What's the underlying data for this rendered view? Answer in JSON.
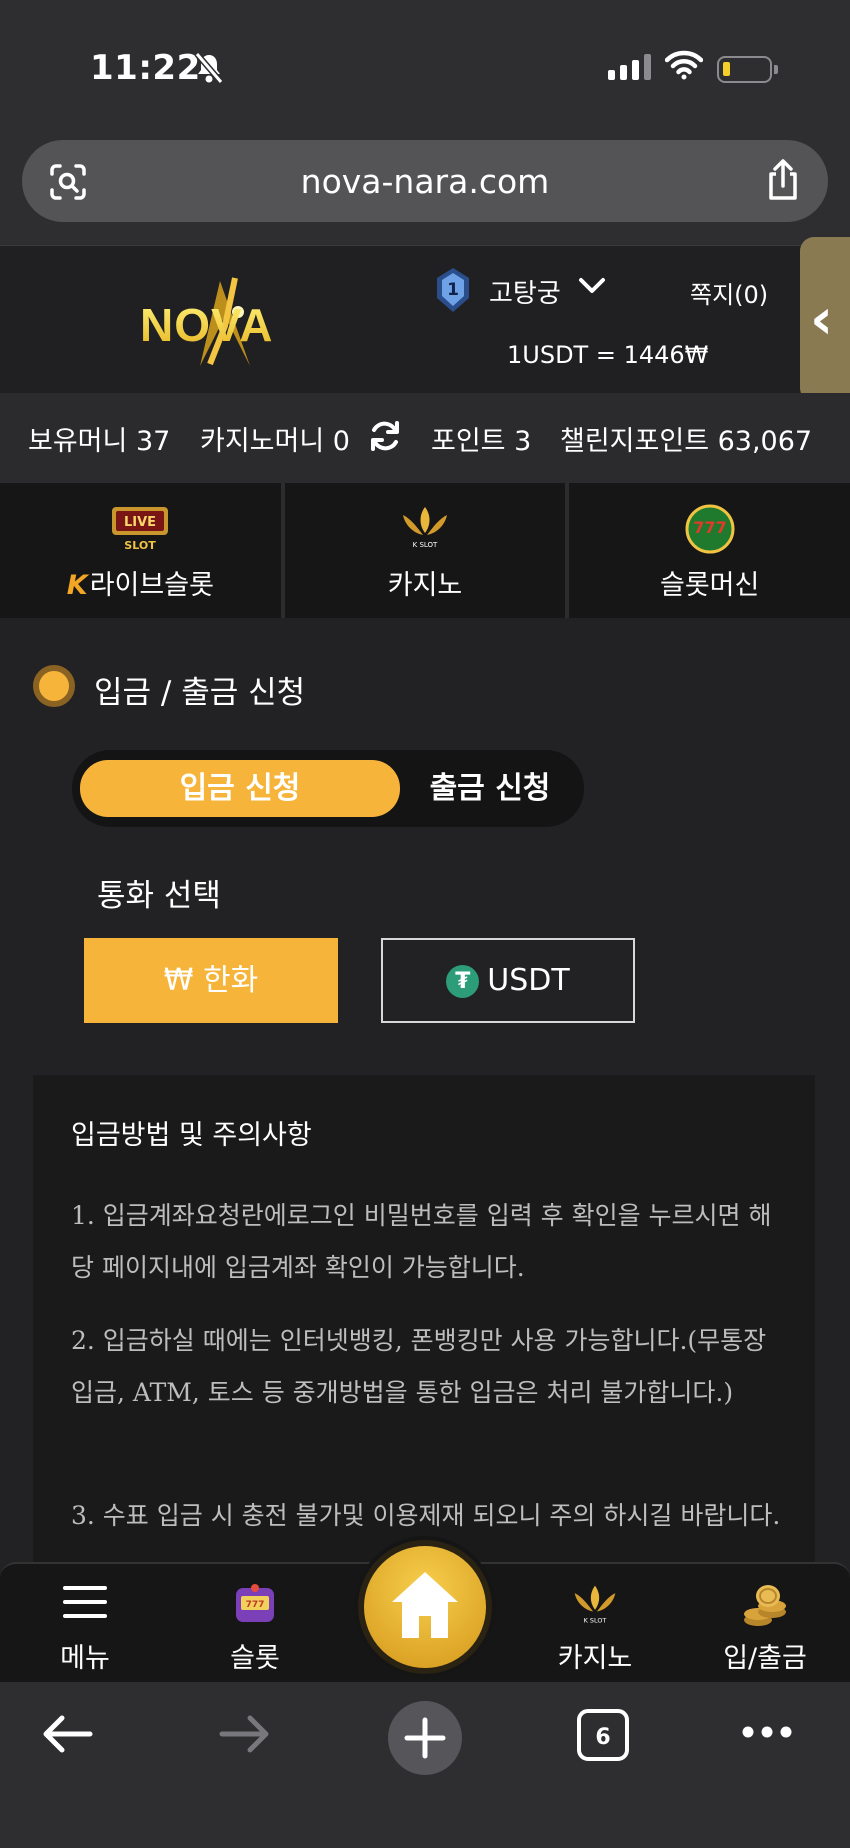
{
  "status_bar": {
    "time": "11:22"
  },
  "address_bar": {
    "url": "nova-nara.com"
  },
  "header": {
    "logo_text": "NOVA",
    "rank_level": "1",
    "username": "고탕궁",
    "messages": "쪽지(0)",
    "exchange_rate": "1USDT = 1446₩"
  },
  "balances": {
    "holding": "보유머니 37",
    "casino": "카지노머니 0",
    "points": "포인트 3",
    "challenge": "챌린지포인트 63,067"
  },
  "categories": {
    "live_slot": "라이브슬롯",
    "live_slot_prefix": "K",
    "casino": "카지노",
    "slot_machine": "슬롯머신"
  },
  "page": {
    "title": "입금 / 출금 신청",
    "tab_deposit": "입금 신청",
    "tab_withdraw": "출금 신청",
    "currency_label": "통화 선택",
    "currency_krw": "₩ 한화",
    "currency_usdt": "USDT",
    "tether_symbol": "₮"
  },
  "notice": {
    "title": "입금방법 및 주의사항",
    "items": [
      "1. 입금계좌요청란에로그인 비밀번호를 입력 후 확인을 누르시면 해당 페이지내에 입금계좌 확인이 가능합니다.",
      "2. 입금하실 때에는 인터넷뱅킹, 폰뱅킹만 사용 가능합니다.(무통장입금, ATM, 토스 등 중개방법을 통한 입금은 처리 불가합니다.)",
      "3. 수표 입금 시 충전 불가및 이용제재 되오니 주의 하시길 바랍니다."
    ]
  },
  "bottom_nav": {
    "menu": "메뉴",
    "slot": "슬롯",
    "casino": "카지노",
    "banking": "입/출금"
  },
  "browser": {
    "tab_count": "6"
  },
  "colors": {
    "accent": "#f6b43a",
    "background": "#222224",
    "tether": "#2d9c79"
  }
}
